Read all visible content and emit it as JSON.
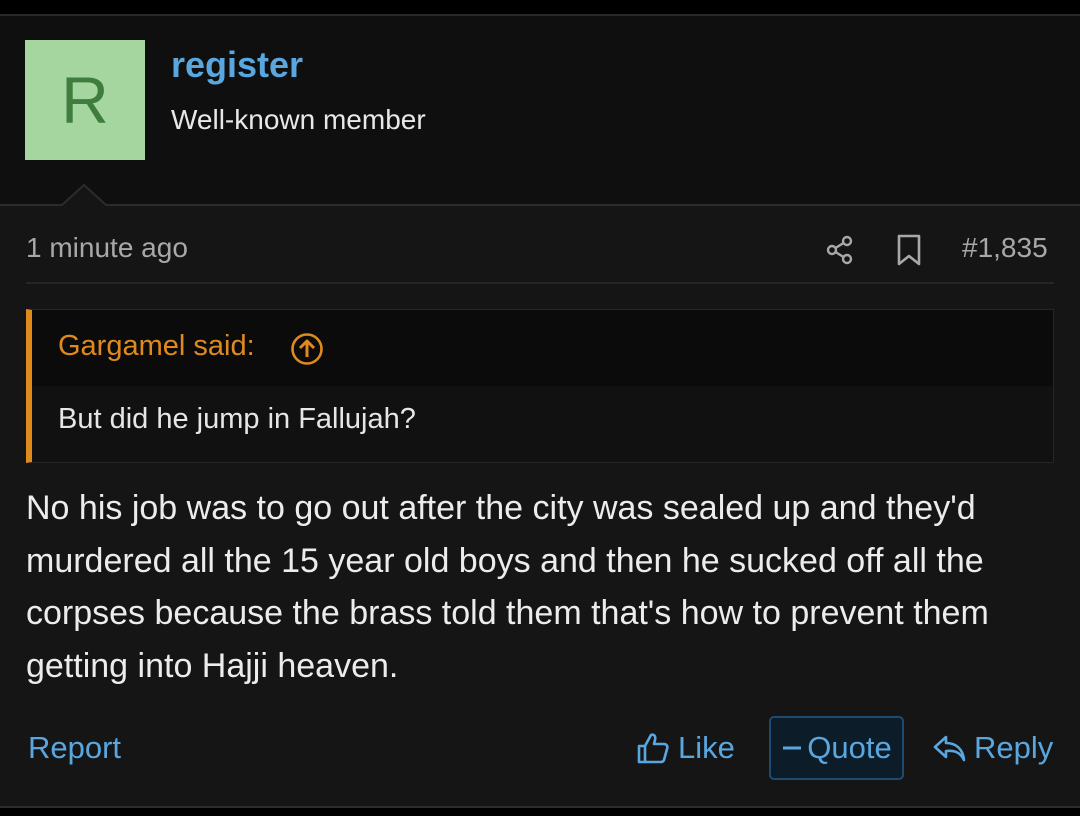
{
  "user": {
    "avatar_letter": "R",
    "avatar_bg": "#a5d6a0",
    "avatar_fg": "#3f7d3c",
    "name": "register",
    "title": "Well-known member"
  },
  "post": {
    "time": "1 minute ago",
    "icons": [
      "share-icon",
      "bookmark-icon"
    ],
    "number": "#1,835",
    "quote": {
      "author": "Gargamel said:",
      "author_icon": "arrow-up-circle-icon",
      "text": "But did he jump in Fallujah?"
    },
    "message": "No his job was to go out after the city was sealed up and they'd murdered all the 15 year old boys and then he sucked off all the corpses because the brass told them that's how to prevent them getting into Hajji heaven."
  },
  "actions": {
    "report": "Report",
    "like": "Like",
    "quote": "Quote",
    "reply": "Reply"
  },
  "colors": {
    "link": "#5aa7df",
    "quote_accent": "#e08a1e",
    "background": "#151515"
  }
}
